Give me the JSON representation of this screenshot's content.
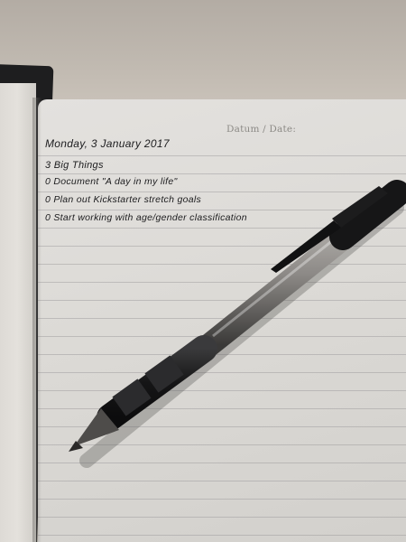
{
  "notebook": {
    "date_label": "Datum / Date:",
    "heading": "Monday, 3 January 2017",
    "subheading": "3 Big Things",
    "items": [
      "0 Document \"A day in my life\"",
      "0 Plan out Kickstarter stretch goals",
      "0 Start working with age/gender classification"
    ]
  },
  "objects": {
    "pen": "retractable-ballpoint-pen",
    "cover": "black-notebook-cover"
  },
  "colors": {
    "paper": "#dddbd7",
    "ink": "#1c1c1e",
    "pen_barrel": "#1a1a1b",
    "table": "#bdb7ae"
  }
}
